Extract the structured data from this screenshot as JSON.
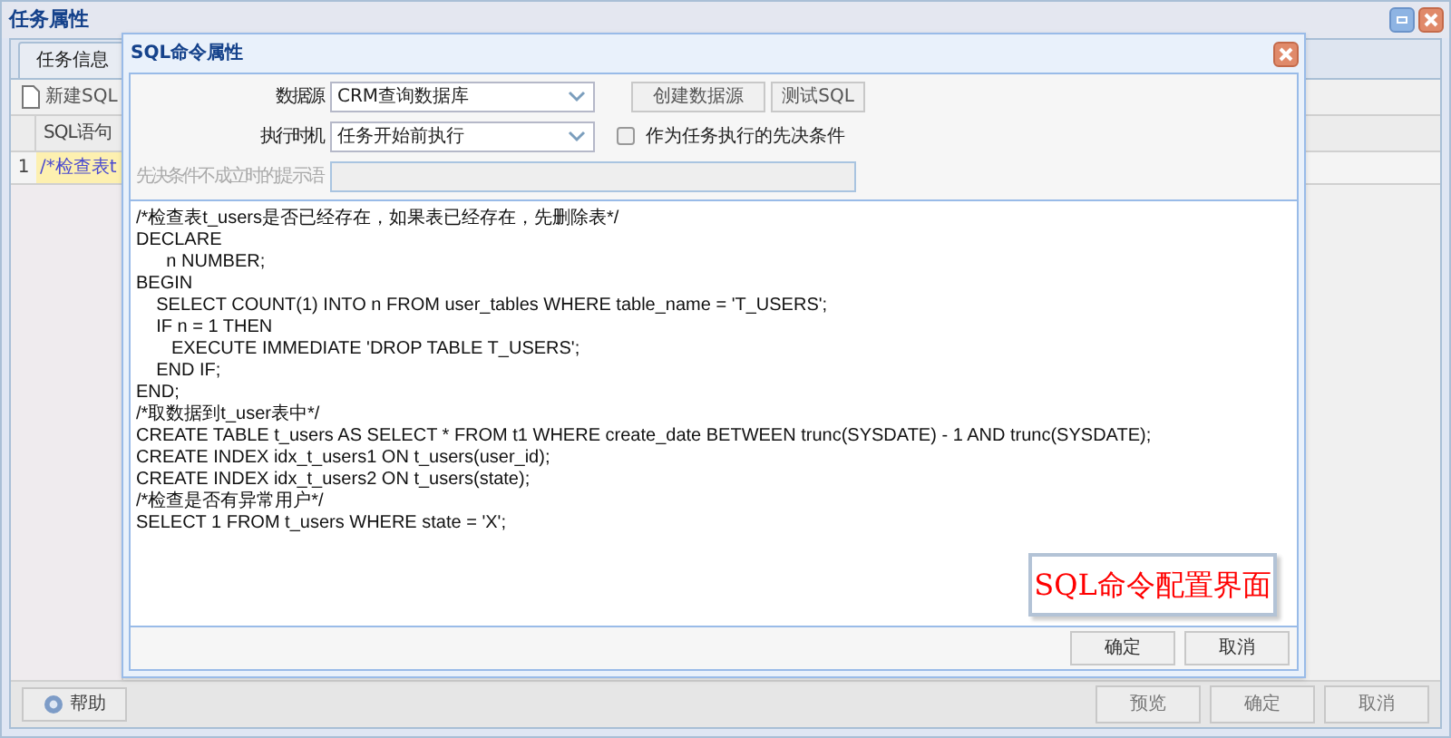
{
  "window": {
    "title": "任务属性"
  },
  "tabs": [
    {
      "label": "任务信息",
      "selected": false
    }
  ],
  "toolbar": {
    "new_button": "新建SQL"
  },
  "grid": {
    "columns": [
      "SQL语句"
    ],
    "rows": [
      {
        "number": "1",
        "sql": "/*检查表t",
        "selected": true
      }
    ]
  },
  "footer": {
    "help": "帮助",
    "buttons": [
      "预览",
      "确定",
      "取消"
    ]
  },
  "dialog": {
    "title": "SQL命令属性",
    "datasource": {
      "label": "数据源",
      "value": "CRM查询数据库"
    },
    "buttons_top": [
      "创建数据源",
      "测试SQL"
    ],
    "timing": {
      "label": "执行时机",
      "value": "任务开始前执行"
    },
    "precondition": {
      "label": "作为任务执行的先决条件",
      "checked": false
    },
    "hint": {
      "label": "先决条件不成立时的提示语",
      "disabled": true
    },
    "sql": "/*检查表t_users是否已经存在，如果表已经存在，先删除表*/\nDECLARE\n      n NUMBER;\nBEGIN\n    SELECT COUNT(1) INTO n FROM user_tables WHERE table_name = 'T_USERS';\n    IF n = 1 THEN\n       EXECUTE IMMEDIATE 'DROP TABLE T_USERS';\n    END IF;\nEND;\n/*取数据到t_user表中*/\nCREATE TABLE t_users AS SELECT * FROM t1 WHERE create_date BETWEEN trunc(SYSDATE) - 1 AND trunc(SYSDATE);\nCREATE INDEX idx_t_users1 ON t_users(user_id);\nCREATE INDEX idx_t_users2 ON t_users(state);\n/*检查是否有异常用户*/\nSELECT 1 FROM t_users WHERE state = 'X';",
    "buttons": [
      "确定",
      "取消"
    ]
  },
  "callout": "SQL命令配置界面"
}
